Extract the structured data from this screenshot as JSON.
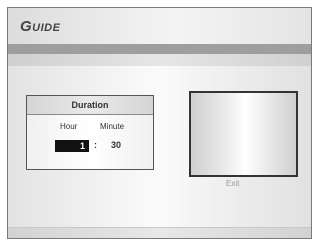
{
  "header": {
    "title": "Guide"
  },
  "duration": {
    "heading": "Duration",
    "hour_label": "Hour",
    "minute_label": "Minute",
    "hour_value": "1",
    "separator": ":",
    "minute_value": "30"
  },
  "preview": {
    "exit_label": "Exit"
  }
}
